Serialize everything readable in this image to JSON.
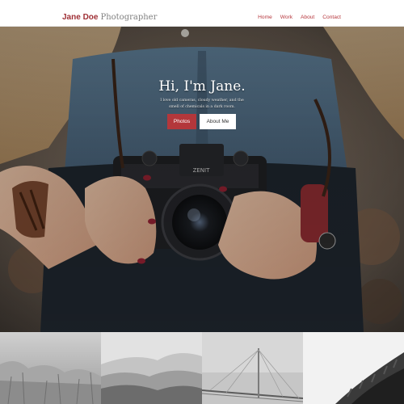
{
  "header": {
    "brand_name": "Jane Doe",
    "brand_suffix": "Photographer",
    "nav": [
      "Home",
      "Work",
      "About",
      "Contact"
    ],
    "brand_color": "#9f2f35",
    "link_color": "#b6373d"
  },
  "hero": {
    "title": "Hi, I'm Jane.",
    "subtitle": "I love old cameras, cloudy weather, and the smell of chemicals in a dark room.",
    "primary_button": "Photos",
    "secondary_button": "About Me",
    "primary_color": "#b3373b",
    "camera_label": "ZENIT"
  },
  "gallery": {
    "tiles": [
      {
        "subject": "grass field"
      },
      {
        "subject": "misty mountains"
      },
      {
        "subject": "bridge in fog"
      },
      {
        "subject": "forest slope"
      }
    ]
  }
}
